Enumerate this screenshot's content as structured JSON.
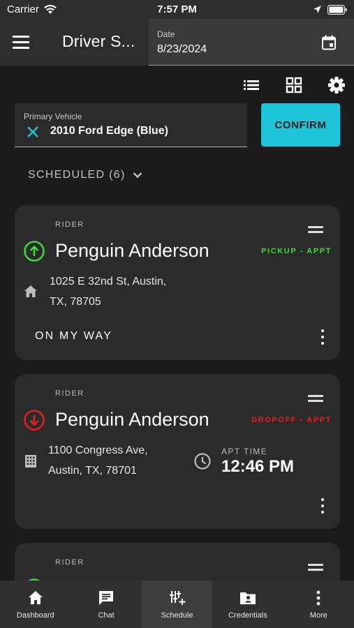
{
  "status_bar": {
    "carrier": "Carrier",
    "time": "7:57 PM"
  },
  "appbar": {
    "title": "Driver S...",
    "date_label": "Date",
    "date_value": "8/23/2024"
  },
  "vehicle": {
    "label": "Primary Vehicle",
    "value": "2010 Ford Edge (Blue)",
    "confirm_label": "CONFIRM"
  },
  "scheduled": {
    "label": "SCHEDULED (6)"
  },
  "cards": [
    {
      "rider_label": "RIDER",
      "name": "Penguin Anderson",
      "trip_type": "PICKUP - APPT",
      "trip_color": "#3ed63e",
      "address_line1": "1025 E 32nd St, Austin,",
      "address_line2": "TX, 78705",
      "action_label": "ON MY WAY"
    },
    {
      "rider_label": "RIDER",
      "name": "Penguin Anderson",
      "trip_type": "DROPOFF - APPT",
      "trip_color": "#e02020",
      "address_line1": "1100 Congress Ave,",
      "address_line2": "Austin, TX, 78701",
      "appt_label": "APT TIME",
      "appt_time": "12:46 PM"
    },
    {
      "rider_label": "RIDER"
    }
  ],
  "bottom_nav": {
    "items": [
      {
        "label": "Dashboard",
        "icon": "home-icon"
      },
      {
        "label": "Chat",
        "icon": "chat-icon"
      },
      {
        "label": "Schedule",
        "icon": "schedule-icon",
        "active": true
      },
      {
        "label": "Credentials",
        "icon": "credentials-icon"
      },
      {
        "label": "More",
        "icon": "more-vertical-icon"
      }
    ]
  },
  "colors": {
    "accent": "#1ec4d8",
    "pickup": "#3ed63e",
    "dropoff": "#e02020",
    "background": "#1b1b1b",
    "card": "#2b2b2b"
  }
}
